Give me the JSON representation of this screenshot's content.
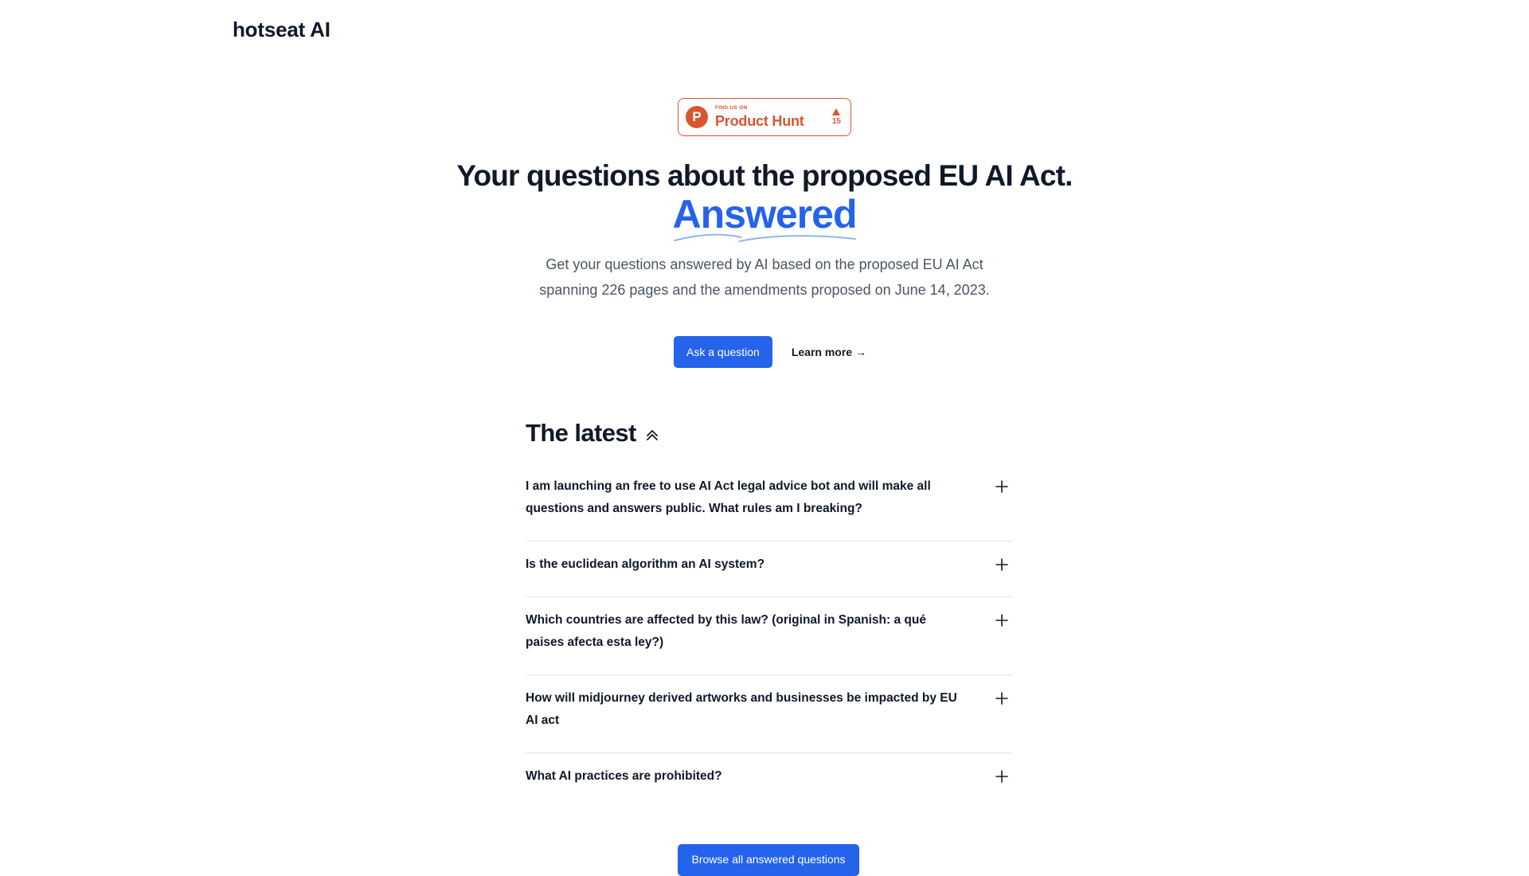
{
  "header": {
    "brand": "hotseat AI"
  },
  "product_hunt": {
    "logo_letter": "P",
    "small_text": "FIND US ON",
    "big_text": "Product Hunt",
    "votes": "15",
    "color": "#da552f"
  },
  "hero": {
    "headline": "Your questions about the proposed EU AI Act.",
    "highlight": "Answered",
    "subtitle_line1": "Get your questions answered by AI based on the proposed EU AI Act",
    "subtitle_line2": "spanning 226 pages and the amendments proposed on June 14, 2023.",
    "primary_cta": "Ask a question",
    "secondary_cta": "Learn more →",
    "accent_color": "#2563eb"
  },
  "latest": {
    "title": "The latest",
    "icon": "chevron-double-up-icon",
    "questions": [
      {
        "text": "I am launching an free to use AI Act legal advice bot and will make all questions and answers public. What rules am I breaking?"
      },
      {
        "text": "Is the euclidean algorithm an AI system?"
      },
      {
        "text": "Which countries are affected by this law? (original in Spanish: a qué paises afecta esta ley?)"
      },
      {
        "text": "How will midjourney derived artworks and businesses be impacted by EU AI act"
      },
      {
        "text": "What AI practices are prohibited?"
      }
    ],
    "browse_label": "Browse all answered questions"
  }
}
